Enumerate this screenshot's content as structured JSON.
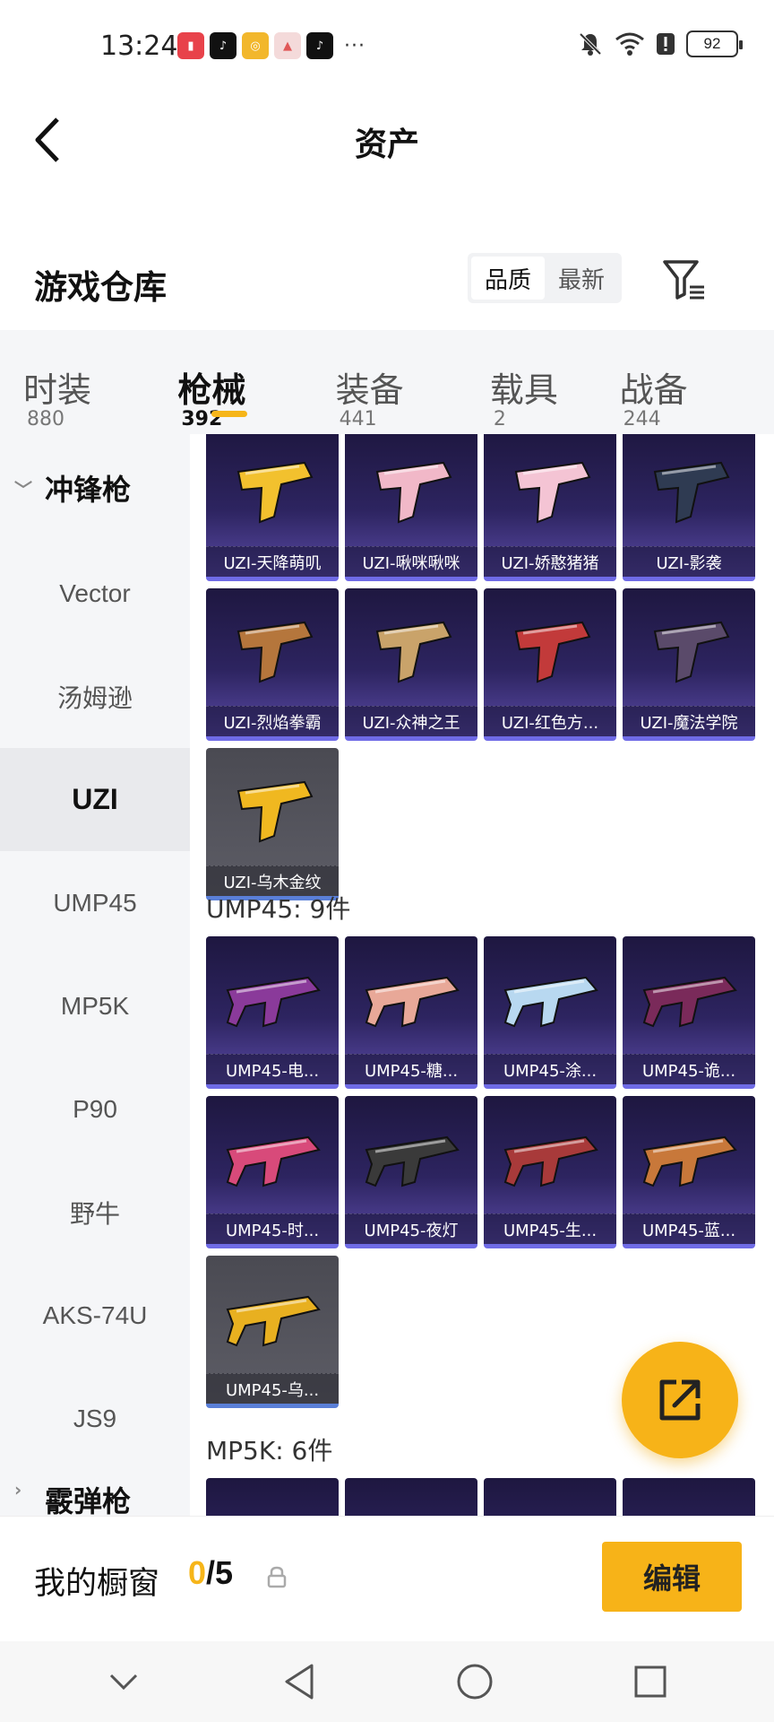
{
  "status_bar": {
    "time": "13:24",
    "more": "···",
    "battery": "92"
  },
  "header": {
    "title": "资产"
  },
  "warehouse": {
    "title": "游戏仓库",
    "sort_options": [
      "品质",
      "最新"
    ]
  },
  "tabs": [
    {
      "label": "时装",
      "count": "880"
    },
    {
      "label": "枪械",
      "count": "392"
    },
    {
      "label": "装备",
      "count": "441"
    },
    {
      "label": "载具",
      "count": "2"
    },
    {
      "label": "战备",
      "count": "244"
    }
  ],
  "sidebar": {
    "category": "冲锋枪",
    "items": [
      "Vector",
      "汤姆逊",
      "UZI",
      "UMP45",
      "MP5K",
      "P90",
      "野牛",
      "AKS-74U",
      "JS9"
    ],
    "next_category": "霰弹枪"
  },
  "uzi_items": [
    "UZI-天降萌叽",
    "UZI-啾咪啾咪",
    "UZI-娇憨猪猪",
    "UZI-影袭",
    "UZI-烈焰拳霸",
    "UZI-众神之王",
    "UZI-红色方...",
    "UZI-魔法学院",
    "UZI-乌木金纹"
  ],
  "ump_section": {
    "title": "UMP45: 9件"
  },
  "ump_items": [
    "UMP45-电...",
    "UMP45-糖...",
    "UMP45-涂...",
    "UMP45-诡...",
    "UMP45-时...",
    "UMP45-夜灯",
    "UMP45-生...",
    "UMP45-蓝...",
    "UMP45-乌..."
  ],
  "mp5k_section": {
    "title": "MP5K: 6件"
  },
  "bottom_bar": {
    "label": "我的橱窗",
    "current": "0",
    "total": "/5",
    "edit_label": "编辑"
  },
  "colors": {
    "accent": "#f7b318",
    "card_bg": "#2d2460",
    "card_border": "#6f6be6"
  }
}
